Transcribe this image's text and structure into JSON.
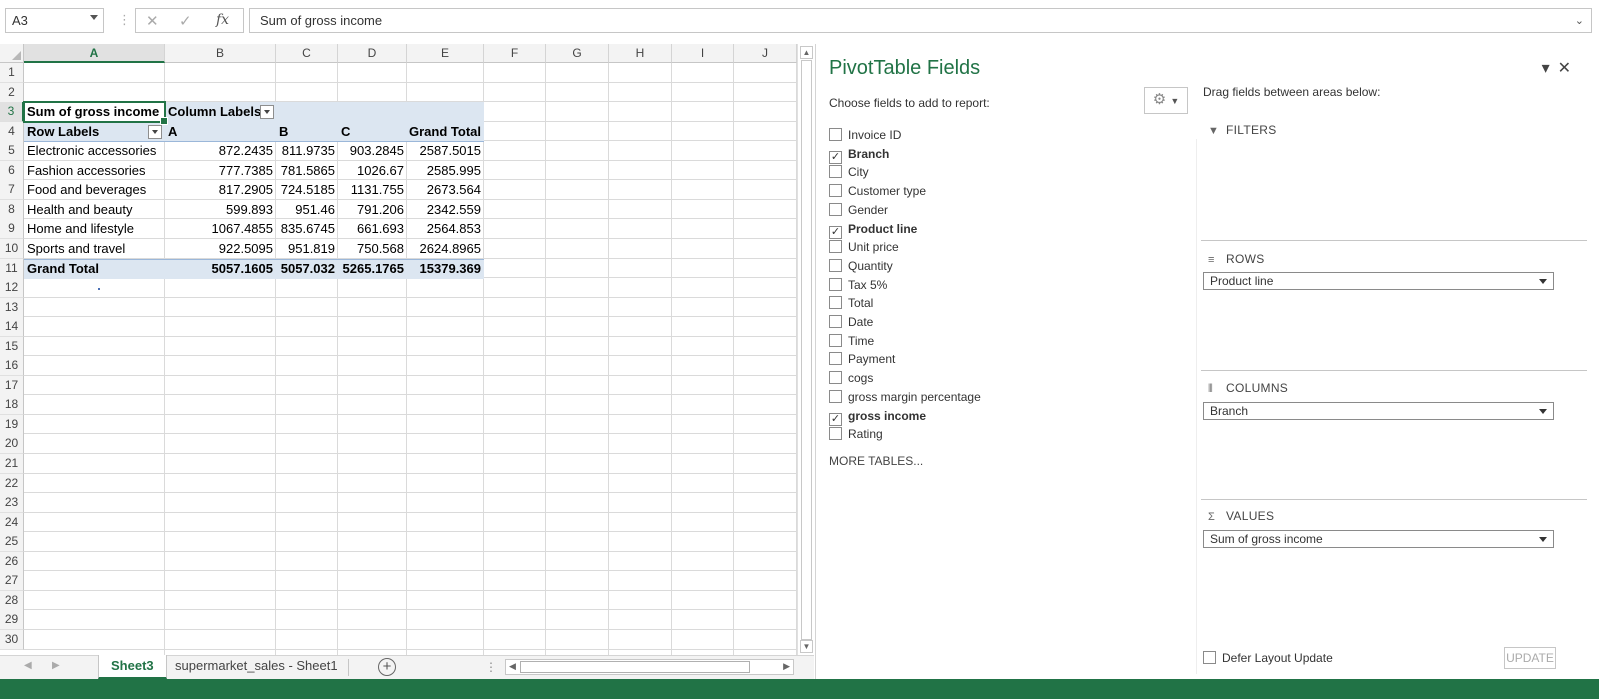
{
  "formula_bar": {
    "name_box": "A3",
    "cancel_icon": "✕",
    "enter_icon": "✓",
    "fx_label": "fx",
    "formula": "Sum of gross income"
  },
  "grid": {
    "columns": [
      "A",
      "B",
      "C",
      "D",
      "E",
      "F",
      "G",
      "H",
      "I",
      "J"
    ],
    "rows": [
      "1",
      "2",
      "3",
      "4",
      "5",
      "6",
      "7",
      "8",
      "9",
      "10",
      "11",
      "12",
      "13",
      "14",
      "15",
      "16",
      "17",
      "18",
      "19",
      "20",
      "21",
      "22",
      "23",
      "24",
      "25",
      "26",
      "27",
      "28",
      "29",
      "30"
    ],
    "selected_cell": "A3"
  },
  "pivot": {
    "values_header": "Sum of gross income",
    "column_labels": "Column Labels",
    "row_labels": "Row Labels",
    "col_values": [
      "A",
      "B",
      "C"
    ],
    "grand_total_label": "Grand Total",
    "rows": [
      {
        "label": "Electronic accessories",
        "a": "872.2435",
        "b": "811.9735",
        "c": "903.2845",
        "total": "2587.5015"
      },
      {
        "label": "Fashion accessories",
        "a": "777.7385",
        "b": "781.5865",
        "c": "1026.67",
        "total": "2585.995"
      },
      {
        "label": "Food and beverages",
        "a": "817.2905",
        "b": "724.5185",
        "c": "1131.755",
        "total": "2673.564"
      },
      {
        "label": "Health and beauty",
        "a": "599.893",
        "b": "951.46",
        "c": "791.206",
        "total": "2342.559"
      },
      {
        "label": "Home and lifestyle",
        "a": "1067.4855",
        "b": "835.6745",
        "c": "661.693",
        "total": "2564.853"
      },
      {
        "label": "Sports and travel",
        "a": "922.5095",
        "b": "951.819",
        "c": "750.568",
        "total": "2624.8965"
      }
    ],
    "grand_total": {
      "label": "Grand Total",
      "a": "5057.1605",
      "b": "5057.032",
      "c": "5265.1765",
      "total": "15379.369"
    }
  },
  "sheet_tabs": {
    "tabs": [
      "Sheet3",
      "supermarket_sales - Sheet1"
    ],
    "active": "Sheet3",
    "add_icon": "+"
  },
  "pane": {
    "title": "PivotTable Fields",
    "choose_text": "Choose fields to add to report:",
    "gear_icon": "⚙",
    "fields": [
      {
        "name": "Invoice ID",
        "checked": false
      },
      {
        "name": "Branch",
        "checked": true
      },
      {
        "name": "City",
        "checked": false
      },
      {
        "name": "Customer type",
        "checked": false
      },
      {
        "name": "Gender",
        "checked": false
      },
      {
        "name": "Product line",
        "checked": true
      },
      {
        "name": "Unit price",
        "checked": false
      },
      {
        "name": "Quantity",
        "checked": false
      },
      {
        "name": "Tax 5%",
        "checked": false
      },
      {
        "name": "Total",
        "checked": false
      },
      {
        "name": "Date",
        "checked": false
      },
      {
        "name": "Time",
        "checked": false
      },
      {
        "name": "Payment",
        "checked": false
      },
      {
        "name": "cogs",
        "checked": false
      },
      {
        "name": "gross margin percentage",
        "checked": false
      },
      {
        "name": "gross income",
        "checked": true
      },
      {
        "name": "Rating",
        "checked": false
      }
    ],
    "more_tables": "MORE TABLES...",
    "drag_text": "Drag fields between areas below:",
    "areas": {
      "filters": "FILTERS",
      "rows": "ROWS",
      "rows_value": "Product line",
      "columns": "COLUMNS",
      "columns_value": "Branch",
      "values": "VALUES",
      "values_value": "Sum of gross income"
    },
    "defer_label": "Defer Layout Update",
    "update_label": "UPDATE"
  },
  "colors": {
    "accent": "#217346",
    "pivot_header_bg": "#dce6f1"
  }
}
